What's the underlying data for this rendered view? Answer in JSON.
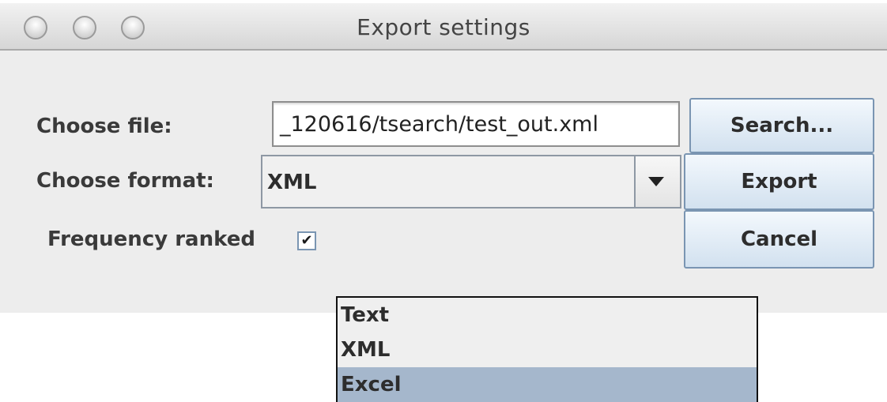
{
  "window": {
    "title": "Export settings"
  },
  "form": {
    "file_label": "Choose file:",
    "file_value": "_120616/tsearch/test_out.xml",
    "format_label": "Choose format:",
    "format_value": "XML",
    "frequency_label": "Frequency ranked",
    "frequency_checked": true,
    "check_glyph": "✔"
  },
  "buttons": {
    "search": "Search...",
    "export": "Export",
    "cancel": "Cancel"
  },
  "dropdown": {
    "options": [
      "Text",
      "XML",
      "Excel"
    ],
    "highlighted": "Excel"
  },
  "icons": {
    "traffic_lights": [
      "close-light-icon",
      "minimize-light-icon",
      "zoom-light-icon"
    ],
    "combo_arrow": "chevron-down-icon",
    "checkmark": "checkmark-icon"
  },
  "colors": {
    "button_border": "#7a95b2",
    "selection_highlight": "#a5b7cc"
  }
}
